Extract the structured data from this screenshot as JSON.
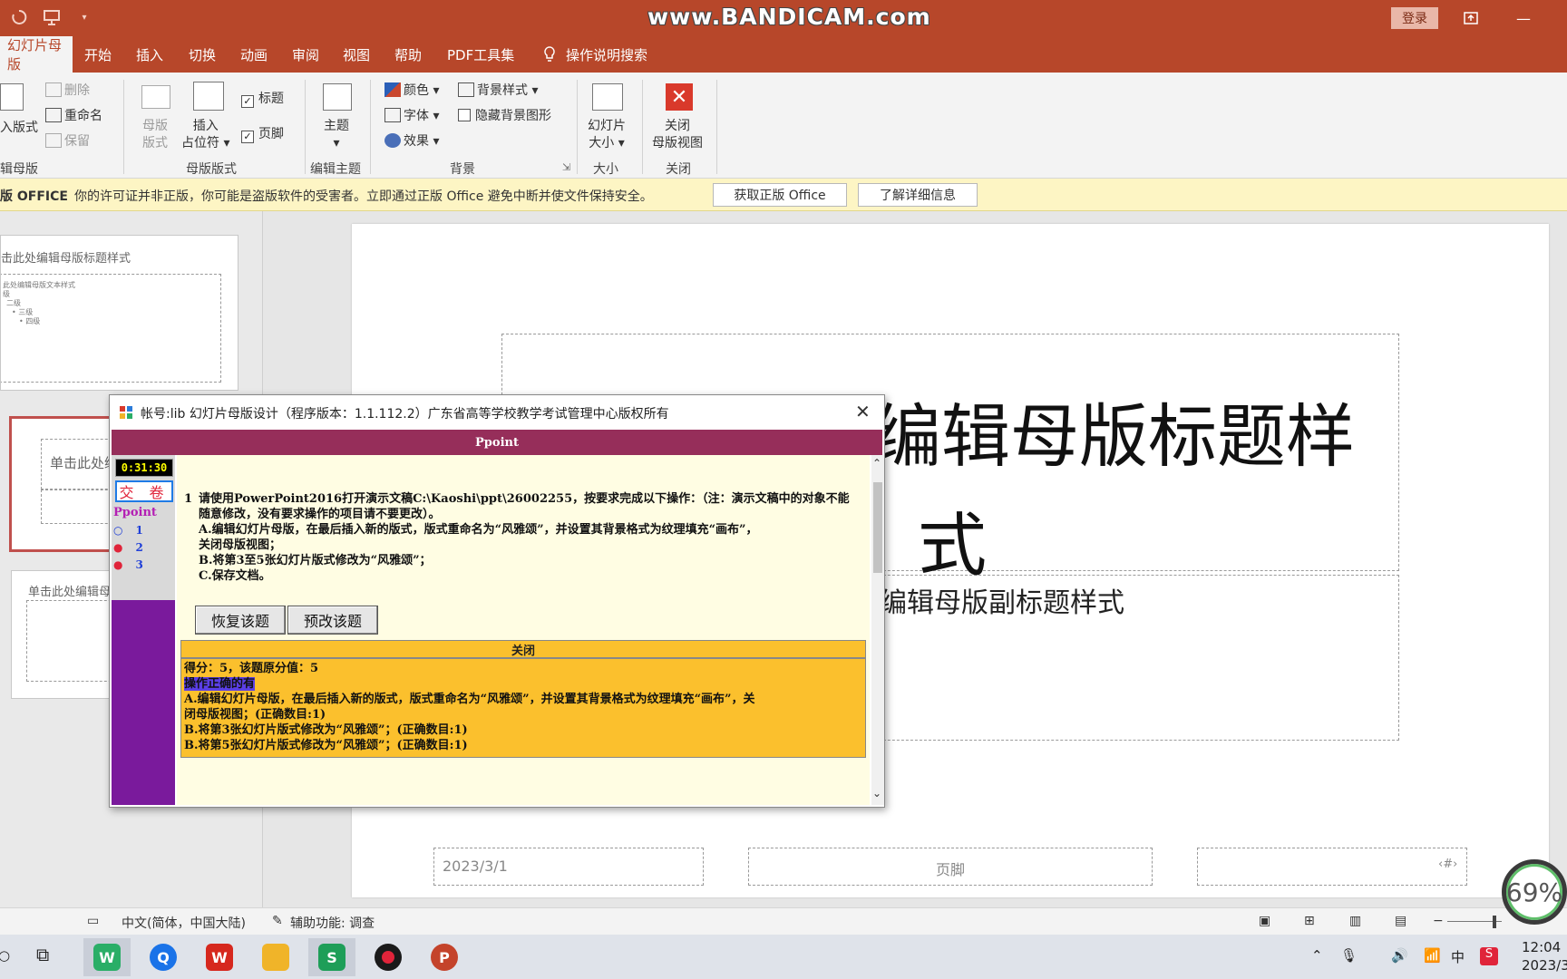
{
  "titlebar": {
    "watermark": "www.BANDICAM.com",
    "login_label": "登录",
    "qat_icons": [
      "save-icon",
      "presenter-icon",
      "dropdown-icon"
    ]
  },
  "menu": {
    "tabs": [
      "幻灯片母版",
      "开始",
      "插入",
      "切换",
      "动画",
      "审阅",
      "视图",
      "帮助",
      "PDF工具集"
    ],
    "search_hint": "操作说明搜索"
  },
  "ribbon": {
    "edit_master": {
      "insert_layout": "入版式",
      "delete": "删除",
      "rename": "重命名",
      "preserve": "保留",
      "group_label": "辑母版"
    },
    "master_layout": {
      "master_layout_btn": [
        "母版",
        "版式"
      ],
      "insert_placeholder": [
        "插入",
        "占位符"
      ],
      "title_checkbox": "标题",
      "footer_checkbox": "页脚",
      "group_label": "母版版式"
    },
    "edit_theme": {
      "theme_btn": "主题",
      "group_label": "编辑主题"
    },
    "background": {
      "colors": "颜色",
      "fonts": "字体",
      "effects": "效果",
      "background_styles": "背景样式",
      "hide_bg_graphics": "隐藏背景图形",
      "group_label": "背景"
    },
    "size": {
      "slide_size": [
        "幻灯片",
        "大小"
      ],
      "group_label": "大小"
    },
    "close": {
      "close_master": [
        "关闭",
        "母版视图"
      ],
      "group_label": "关闭"
    }
  },
  "notification": {
    "brand": "版 OFFICE",
    "message": "你的许可证并非正版，你可能是盗版软件的受害者。立即通过正版 Office 避免中断并使文件保持安全。",
    "get_genuine": "获取正版 Office",
    "learn_more": "了解详细信息"
  },
  "thumbnails": {
    "thumb1_title": "击此处编辑母版标题样式",
    "thumb1_body": [
      "此处编辑母版文本样式",
      "级",
      "二级",
      "• 三级",
      "• 四级"
    ],
    "thumb2_title": "单击此处编",
    "thumb3_title": "单击此处编辑母版"
  },
  "slide": {
    "title_line1": "编辑母版标题样",
    "title_line2": "式",
    "subtitle": "编辑母版副标题样式",
    "footer_date": "2023/3/1",
    "footer_center": "页脚",
    "footer_num": "‹#›"
  },
  "dialog": {
    "title": "帐号:lib  幻灯片母版设计（程序版本：1.1.112.2）广东省高等学校教学考试管理中心版权所有",
    "header": "Ppoint",
    "timer": "0:31:30",
    "submit": "交 卷",
    "sidebar_label": "Ppoint",
    "questions": [
      {
        "mark": "○",
        "num": "1",
        "color": "#1f3fd8"
      },
      {
        "mark": "●",
        "num": "2",
        "color": "#e0243a"
      },
      {
        "mark": "●",
        "num": "3",
        "color": "#e0243a"
      }
    ],
    "question_num": "1",
    "question_lines": [
      "请使用PowerPoint2016打开演示文稿C:\\Kaoshi\\ppt\\26002255，按要求完成以下操作：（注：演示文稿中的对象不能",
      "随意修改，没有要求操作的项目请不要更改）。",
      "A.编辑幻灯片母版，在最后插入新的版式，版式重命名为“风雅颂”，并设置其背景格式为纹理填充“画布”，",
      "关闭母版视图；",
      "B.将第3至5张幻灯片版式修改为“风雅颂”；",
      "C.保存文档。"
    ],
    "restore_btn": "恢复该题",
    "grade_btn": "预改该题",
    "result_header": "关闭",
    "score_line": "得分：5，该题原分值：5",
    "correct_label": "操作正确的有",
    "result_lines": [
      "A.编辑幻灯片母版，在最后插入新的版式，版式重命名为“风雅颂”，并设置其背景格式为纹理填充“画布”，关",
      "闭母版视图；(正确数目:1)",
      "B.将第3张幻灯片版式修改为“风雅颂”；(正确数目:1)",
      "B.将第5张幻灯片版式修改为“风雅颂”；(正确数目:1)"
    ]
  },
  "statusbar": {
    "language": "中文(简体，中国大陆)",
    "accessibility": "辅助功能: 调查",
    "zoom_overlay": "69%"
  },
  "taskbar": {
    "apps": [
      {
        "name": "wechat",
        "glyph": "W",
        "color": "#2aae67"
      },
      {
        "name": "browser",
        "glyph": "Q",
        "color": "#1a73e8"
      },
      {
        "name": "wps",
        "glyph": "W",
        "color": "#d6281e"
      },
      {
        "name": "explorer",
        "glyph": "",
        "color": "#f0b429"
      },
      {
        "name": "exam-client",
        "glyph": "S",
        "color": "#1e9e58"
      },
      {
        "name": "recorder",
        "glyph": "●",
        "color": "#1a1a1a"
      },
      {
        "name": "powerpoint",
        "glyph": "P",
        "color": "#c4432b"
      }
    ],
    "ime": "中",
    "time": "12:04",
    "date": "2023/3"
  }
}
